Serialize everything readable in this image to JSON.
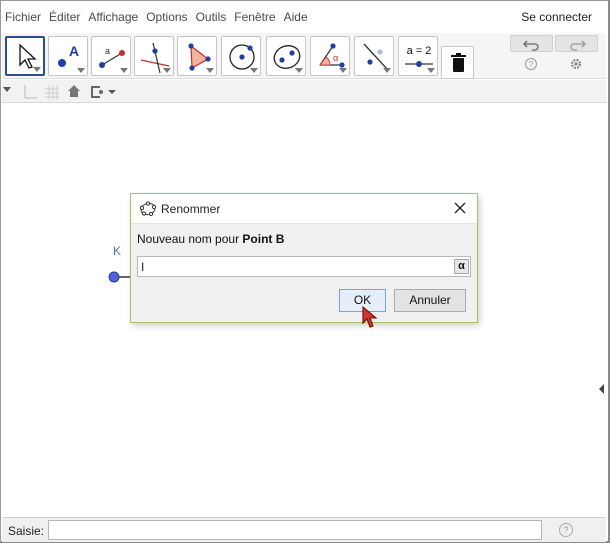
{
  "menu": {
    "items": [
      {
        "label": "Fichier"
      },
      {
        "label": "Éditer"
      },
      {
        "label": "Affichage"
      },
      {
        "label": "Options"
      },
      {
        "label": "Outils"
      },
      {
        "label": "Fenêtre"
      },
      {
        "label": "Aide"
      }
    ],
    "login_label": "Se connecter"
  },
  "toolbar": {
    "tools": [
      {
        "name": "move-tool",
        "icon": "cursor-arrow-icon",
        "selected": true
      },
      {
        "name": "point-tool",
        "icon": "point-A-icon",
        "text": "A"
      },
      {
        "name": "segment-tool",
        "icon": "line-through-two-points-icon",
        "text": "a"
      },
      {
        "name": "perpendicular-tool",
        "icon": "perpendicular-line-icon"
      },
      {
        "name": "polygon-tool",
        "icon": "polygon-icon"
      },
      {
        "name": "circle-center-point-tool",
        "icon": "circle-center-point-icon"
      },
      {
        "name": "ellipse-tool",
        "icon": "ellipse-icon"
      },
      {
        "name": "angle-tool",
        "icon": "angle-icon",
        "text": "α"
      },
      {
        "name": "reflect-tool",
        "icon": "reflect-about-line-icon"
      },
      {
        "name": "slider-tool",
        "icon": "slider-icon",
        "text": "a = 2"
      },
      {
        "name": "delete-tool",
        "icon": "trash-icon"
      }
    ],
    "undo_icon": "undo-icon",
    "redo_icon": "redo-icon",
    "help_icon": "help-icon",
    "settings_icon": "gear-icon"
  },
  "stylebar": {
    "icons": [
      "menu-toggle-icon",
      "axes-icon",
      "grid-icon",
      "home-icon",
      "point-capture-icon"
    ]
  },
  "graphics": {
    "point_label": "K"
  },
  "dialog": {
    "title": "Renommer",
    "label_prefix": "Nouveau nom pour ",
    "label_object": "Point B",
    "input_value": "I",
    "alpha_symbol": "α",
    "ok_label": "OK",
    "cancel_label": "Annuler"
  },
  "input_bar": {
    "label": "Saisie:",
    "value": "",
    "help_symbol": "?"
  },
  "colors": {
    "selected_tool_border": "#2b4d94",
    "point_fill": "#4d63d6",
    "dialog_border": "#9fc55c"
  }
}
